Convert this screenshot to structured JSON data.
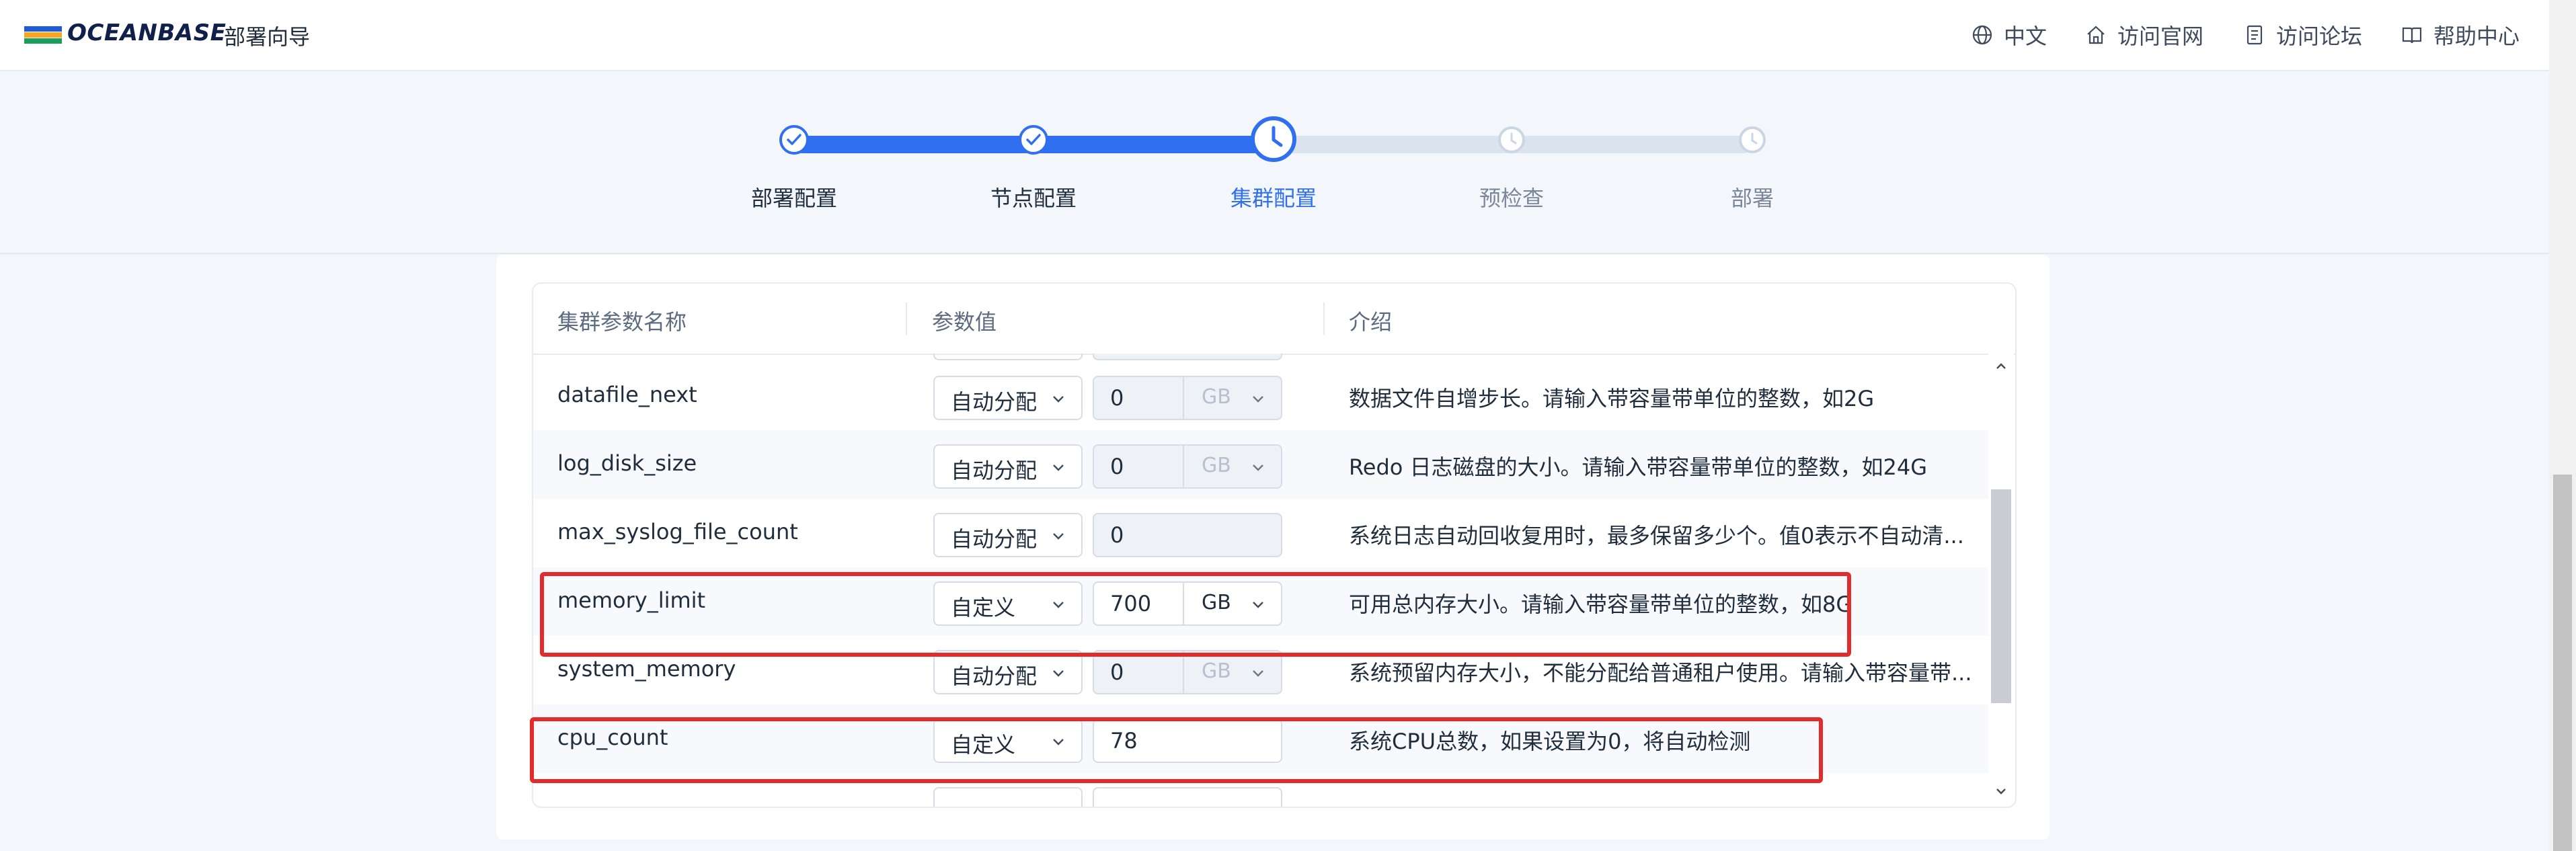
{
  "header": {
    "brand": "OCEANBASE",
    "app_title": "部署向导",
    "nav": [
      {
        "label": "中文",
        "icon": "globe-icon"
      },
      {
        "label": "访问官网",
        "icon": "home-icon"
      },
      {
        "label": "访问论坛",
        "icon": "forum-icon"
      },
      {
        "label": "帮助中心",
        "icon": "book-icon"
      }
    ]
  },
  "steps": [
    {
      "label": "部署配置",
      "status": "done"
    },
    {
      "label": "节点配置",
      "status": "done"
    },
    {
      "label": "集群配置",
      "status": "current"
    },
    {
      "label": "预检查",
      "status": "pending"
    },
    {
      "label": "部署",
      "status": "pending"
    }
  ],
  "table": {
    "headers": [
      "集群参数名称",
      "参数值",
      "介绍"
    ],
    "rows": [
      {
        "name": "datafile_next",
        "mode": "自动分配",
        "value": "0",
        "unit": "GB",
        "unit_disabled": true,
        "desc": "数据文件自增步长。请输入带容量带单位的整数，如2G"
      },
      {
        "name": "log_disk_size",
        "mode": "自动分配",
        "value": "0",
        "unit": "GB",
        "unit_disabled": true,
        "desc": "Redo 日志磁盘的大小。请输入带容量带单位的整数，如24G"
      },
      {
        "name": "max_syslog_file_count",
        "mode": "自动分配",
        "value": "0",
        "unit": "",
        "unit_disabled": true,
        "desc": "系统日志自动回收复用时，最多保留多少个。值0表示不自动清..."
      },
      {
        "name": "memory_limit",
        "mode": "自定义",
        "value": "700",
        "unit": "GB",
        "unit_disabled": false,
        "desc": "可用总内存大小。请输入带容量带单位的整数，如8G"
      },
      {
        "name": "system_memory",
        "mode": "自动分配",
        "value": "0",
        "unit": "GB",
        "unit_disabled": true,
        "desc": "系统预留内存大小，不能分配给普通租户使用。请输入带容量带..."
      },
      {
        "name": "cpu_count",
        "mode": "自定义",
        "value": "78",
        "unit": "",
        "unit_disabled": false,
        "desc": "系统CPU总数，如果设置为0，将自动检测"
      }
    ]
  },
  "colors": {
    "accent": "#2f6ff0",
    "highlight": "#e42b2b",
    "pending": "#dbe3ef"
  }
}
